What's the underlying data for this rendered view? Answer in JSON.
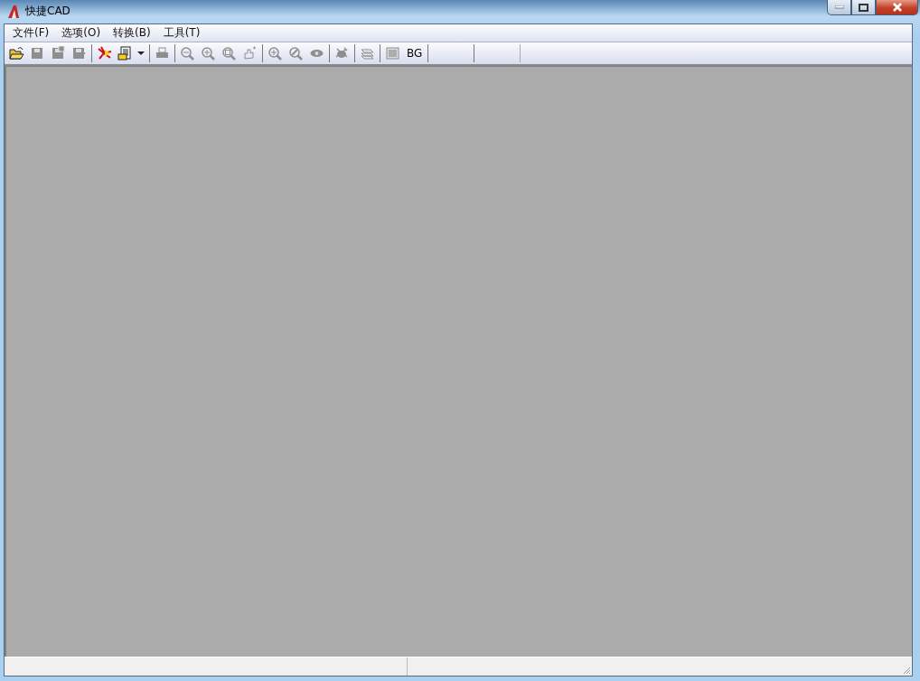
{
  "window": {
    "title": "快捷CAD"
  },
  "menu": [
    "文件(F)",
    "选项(O)",
    "转换(B)",
    "工具(T)"
  ],
  "toolbar": [
    [
      {
        "kind": "open",
        "disabled": false
      },
      {
        "kind": "save",
        "disabled": true
      },
      {
        "kind": "save-as",
        "disabled": true
      },
      {
        "kind": "export",
        "disabled": true
      }
    ],
    [
      {
        "kind": "convert",
        "disabled": false
      },
      {
        "kind": "document",
        "disabled": false
      },
      {
        "kind": "dropdown",
        "disabled": false
      }
    ],
    [
      {
        "kind": "print",
        "disabled": true
      }
    ],
    [
      {
        "kind": "zoom-out",
        "disabled": true
      },
      {
        "kind": "zoom-in",
        "disabled": true
      },
      {
        "kind": "zoom-window",
        "disabled": true
      },
      {
        "kind": "pan",
        "disabled": true
      }
    ],
    [
      {
        "kind": "zoom-all",
        "disabled": true
      },
      {
        "kind": "zoom-realtime",
        "disabled": true
      },
      {
        "kind": "view",
        "disabled": true
      }
    ],
    [
      {
        "kind": "bug",
        "disabled": true
      }
    ],
    [
      {
        "kind": "layers",
        "disabled": true
      }
    ],
    [
      {
        "kind": "grid",
        "disabled": true
      },
      {
        "kind": "text",
        "label": "BG",
        "disabled": false
      }
    ],
    [
      {
        "kind": "empty"
      }
    ],
    [
      {
        "kind": "empty"
      }
    ]
  ]
}
